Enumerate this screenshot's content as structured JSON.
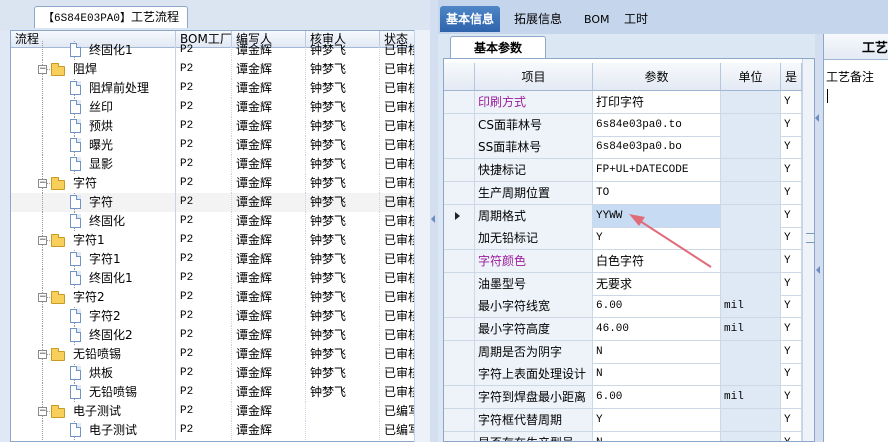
{
  "left_tab": {
    "code": "【6S84E03PA0】",
    "title": "工艺流程"
  },
  "tree_headers": {
    "flow": "流程",
    "bom": "BOM工厂",
    "editor": "编写人",
    "reviewer": "核审人",
    "status": "状态"
  },
  "tree_rows": [
    {
      "name": "终固化1",
      "type": "file",
      "level": 2,
      "bom": "P2",
      "editor": "谭金辉",
      "reviewer": "钟梦飞",
      "status": "已审核"
    },
    {
      "name": "阻焊",
      "type": "folder",
      "level": 1,
      "bom": "P2",
      "editor": "谭金辉",
      "reviewer": "钟梦飞",
      "status": "已审核"
    },
    {
      "name": "阻焊前处理",
      "type": "file",
      "level": 2,
      "bom": "P2",
      "editor": "谭金辉",
      "reviewer": "钟梦飞",
      "status": "已审核"
    },
    {
      "name": "丝印",
      "type": "file",
      "level": 2,
      "bom": "P2",
      "editor": "谭金辉",
      "reviewer": "钟梦飞",
      "status": "已审核"
    },
    {
      "name": "预烘",
      "type": "file",
      "level": 2,
      "bom": "P2",
      "editor": "谭金辉",
      "reviewer": "钟梦飞",
      "status": "已审核"
    },
    {
      "name": "曝光",
      "type": "file",
      "level": 2,
      "bom": "P2",
      "editor": "谭金辉",
      "reviewer": "钟梦飞",
      "status": "已审核"
    },
    {
      "name": "显影",
      "type": "file",
      "level": 2,
      "bom": "P2",
      "editor": "谭金辉",
      "reviewer": "钟梦飞",
      "status": "已审核"
    },
    {
      "name": "字符",
      "type": "folder",
      "level": 1,
      "bom": "P2",
      "editor": "谭金辉",
      "reviewer": "钟梦飞",
      "status": "已审核"
    },
    {
      "name": "字符",
      "type": "file",
      "level": 2,
      "bom": "P2",
      "editor": "谭金辉",
      "reviewer": "钟梦飞",
      "status": "已审核",
      "selected": true
    },
    {
      "name": "终固化",
      "type": "file",
      "level": 2,
      "bom": "P2",
      "editor": "谭金辉",
      "reviewer": "钟梦飞",
      "status": "已审核"
    },
    {
      "name": "字符1",
      "type": "folder",
      "level": 1,
      "bom": "P2",
      "editor": "谭金辉",
      "reviewer": "钟梦飞",
      "status": "已审核"
    },
    {
      "name": "字符1",
      "type": "file",
      "level": 2,
      "bom": "P2",
      "editor": "谭金辉",
      "reviewer": "钟梦飞",
      "status": "已审核"
    },
    {
      "name": "终固化1",
      "type": "file",
      "level": 2,
      "bom": "P2",
      "editor": "谭金辉",
      "reviewer": "钟梦飞",
      "status": "已审核"
    },
    {
      "name": "字符2",
      "type": "folder",
      "level": 1,
      "bom": "P2",
      "editor": "谭金辉",
      "reviewer": "钟梦飞",
      "status": "已审核"
    },
    {
      "name": "字符2",
      "type": "file",
      "level": 2,
      "bom": "P2",
      "editor": "谭金辉",
      "reviewer": "钟梦飞",
      "status": "已审核"
    },
    {
      "name": "终固化2",
      "type": "file",
      "level": 2,
      "bom": "P2",
      "editor": "谭金辉",
      "reviewer": "钟梦飞",
      "status": "已审核"
    },
    {
      "name": "无铅喷锡",
      "type": "folder",
      "level": 1,
      "bom": "P2",
      "editor": "谭金辉",
      "reviewer": "钟梦飞",
      "status": "已审核"
    },
    {
      "name": "烘板",
      "type": "file",
      "level": 2,
      "bom": "P2",
      "editor": "谭金辉",
      "reviewer": "钟梦飞",
      "status": "已审核"
    },
    {
      "name": "无铅喷锡",
      "type": "file",
      "level": 2,
      "bom": "P2",
      "editor": "谭金辉",
      "reviewer": "钟梦飞",
      "status": "已审核"
    },
    {
      "name": "电子测试",
      "type": "folder",
      "level": 1,
      "bom": "P2",
      "editor": "谭金辉",
      "reviewer": "",
      "status": "已编写"
    },
    {
      "name": "电子测试",
      "type": "file",
      "level": 2,
      "bom": "P2",
      "editor": "谭金辉",
      "reviewer": "",
      "status": "已编写"
    }
  ],
  "top_tabs": [
    "基本信息",
    "拓展信息",
    "BOM",
    "工时"
  ],
  "sub_tab": "基本参数",
  "grid_headers": {
    "item": "项目",
    "param": "参数",
    "unit": "单位",
    "flag": "是"
  },
  "grid_rows": [
    {
      "item": "印刷方式",
      "param": "打印字符",
      "unit": "",
      "flag": "Y",
      "purple": true,
      "cjk": true
    },
    {
      "item": "CS面菲林号",
      "param": "6s84e03pa0.to",
      "unit": "",
      "flag": "Y"
    },
    {
      "item": "SS面菲林号",
      "param": "6s84e03pa0.bo",
      "unit": "",
      "flag": "Y"
    },
    {
      "item": "快捷标记",
      "param": "FP+UL+DATECODE",
      "unit": "",
      "flag": "Y"
    },
    {
      "item": "生产周期位置",
      "param": "TO",
      "unit": "",
      "flag": "Y"
    },
    {
      "item": "周期格式",
      "param": "YYWW",
      "unit": "",
      "flag": "Y",
      "current": true
    },
    {
      "item": "加无铅标记",
      "param": "Y",
      "unit": "",
      "flag": "Y"
    },
    {
      "item": "字符颜色",
      "param": "白色字符",
      "unit": "",
      "flag": "Y",
      "purple": true,
      "cjk": true
    },
    {
      "item": "油墨型号",
      "param": "无要求",
      "unit": "",
      "flag": "Y",
      "cjk": true
    },
    {
      "item": "最小字符线宽",
      "param": "6.00",
      "unit": "mil",
      "flag": "Y"
    },
    {
      "item": "最小字符高度",
      "param": "46.00",
      "unit": "mil",
      "flag": "Y"
    },
    {
      "item": "周期是否为阴字",
      "param": "N",
      "unit": "",
      "flag": "Y"
    },
    {
      "item": "字符上表面处理设计",
      "param": "N",
      "unit": "",
      "flag": "Y"
    },
    {
      "item": "字符到焊盘最小距离",
      "param": "6.00",
      "unit": "mil",
      "flag": "Y"
    },
    {
      "item": "字符框代替周期",
      "param": "Y",
      "unit": "",
      "flag": "Y"
    },
    {
      "item": "是否存在生产型号",
      "param": "N",
      "unit": "",
      "flag": "Y"
    }
  ],
  "notes": {
    "tab": "工艺",
    "label": "工艺备注",
    "value": ""
  },
  "colors": {
    "accent": "#2d64ab",
    "highlight": "#c7dbf3",
    "purple_label": "#9b1d9b",
    "arrow": "#e06c7a"
  },
  "icons": {
    "folder": "folder-icon",
    "file": "file-icon",
    "row_pointer": "row-pointer-icon"
  }
}
